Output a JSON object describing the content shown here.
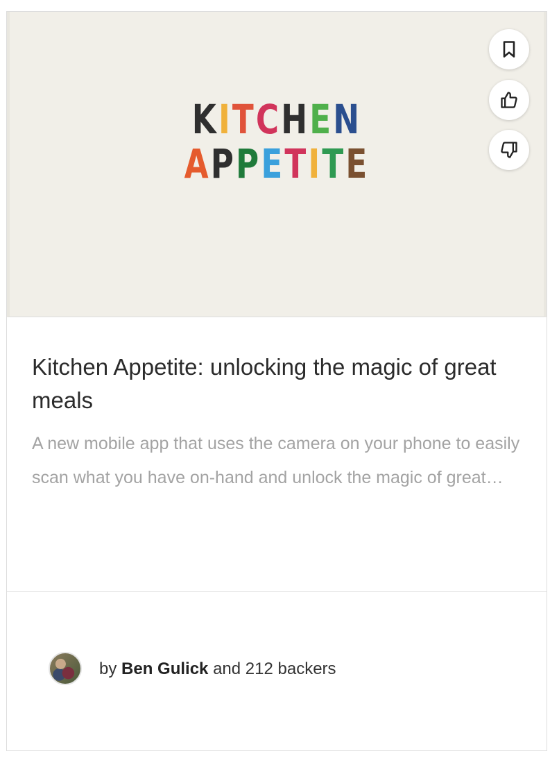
{
  "project": {
    "logo": {
      "line1": [
        {
          "ch": "K",
          "color": "#2f2f2f"
        },
        {
          "ch": "I",
          "color": "#f0b13b"
        },
        {
          "ch": "T",
          "color": "#e0533a"
        },
        {
          "ch": "C",
          "color": "#d1345b"
        },
        {
          "ch": "H",
          "color": "#2f2f2f"
        },
        {
          "ch": "E",
          "color": "#4fb04b"
        },
        {
          "ch": "N",
          "color": "#2b4f8f"
        }
      ],
      "line2": [
        {
          "ch": "A",
          "color": "#e55b2d"
        },
        {
          "ch": "P",
          "color": "#2f2f2f"
        },
        {
          "ch": "P",
          "color": "#1f7a3a"
        },
        {
          "ch": "E",
          "color": "#3aa0dc"
        },
        {
          "ch": "T",
          "color": "#d1345b"
        },
        {
          "ch": "I",
          "color": "#f0b13b"
        },
        {
          "ch": "T",
          "color": "#2f9a52"
        },
        {
          "ch": "E",
          "color": "#7a5030"
        }
      ]
    },
    "title": "Kitchen Appetite: unlocking the magic of great meals",
    "description": "A new mobile app that uses the camera on your phone to easily scan what you have on-hand and unlock the magic of great meals",
    "byline": {
      "prefix": "by",
      "creator": "Ben Gulick",
      "suffix": "and 212 backers"
    }
  },
  "actions": {
    "bookmark_icon": "bookmark-icon",
    "like_icon": "thumbs-up-icon",
    "dislike_icon": "thumbs-down-icon"
  }
}
